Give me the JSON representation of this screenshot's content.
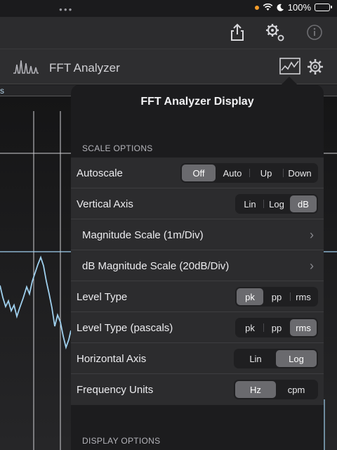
{
  "status": {
    "battery": "100%",
    "battery_fraction": 1.0
  },
  "nav": {
    "title": "FFT Analyzer"
  },
  "plot": {
    "label": "s"
  },
  "popover": {
    "title": "FFT Analyzer Display",
    "scale_header": "SCALE OPTIONS",
    "display_header": "DISPLAY OPTIONS",
    "autoscale": {
      "label": "Autoscale",
      "options": [
        "Off",
        "Auto",
        "Up",
        "Down"
      ],
      "selected": "Off"
    },
    "vertical_axis": {
      "label": "Vertical Axis",
      "options": [
        "Lin",
        "Log",
        "dB"
      ],
      "selected": "dB"
    },
    "magnitude_scale": {
      "label": "Magnitude Scale (1m/Div)"
    },
    "db_magnitude_scale": {
      "label": "dB Magnitude Scale (20dB/Div)"
    },
    "level_type": {
      "label": "Level Type",
      "options": [
        "pk",
        "pp",
        "rms"
      ],
      "selected": "pk"
    },
    "level_type_pascals": {
      "label": "Level Type (pascals)",
      "options": [
        "pk",
        "pp",
        "rms"
      ],
      "selected": "rms"
    },
    "horizontal_axis": {
      "label": "Horizontal Axis",
      "options": [
        "Lin",
        "Log"
      ],
      "selected": "Log"
    },
    "frequency_units": {
      "label": "Frequency Units",
      "options": [
        "Hz",
        "cpm"
      ],
      "selected": "Hz"
    }
  },
  "colors": {
    "accent": "#9fd0ee",
    "battery": "#4cd964",
    "location_dot": "#f39c2a"
  }
}
